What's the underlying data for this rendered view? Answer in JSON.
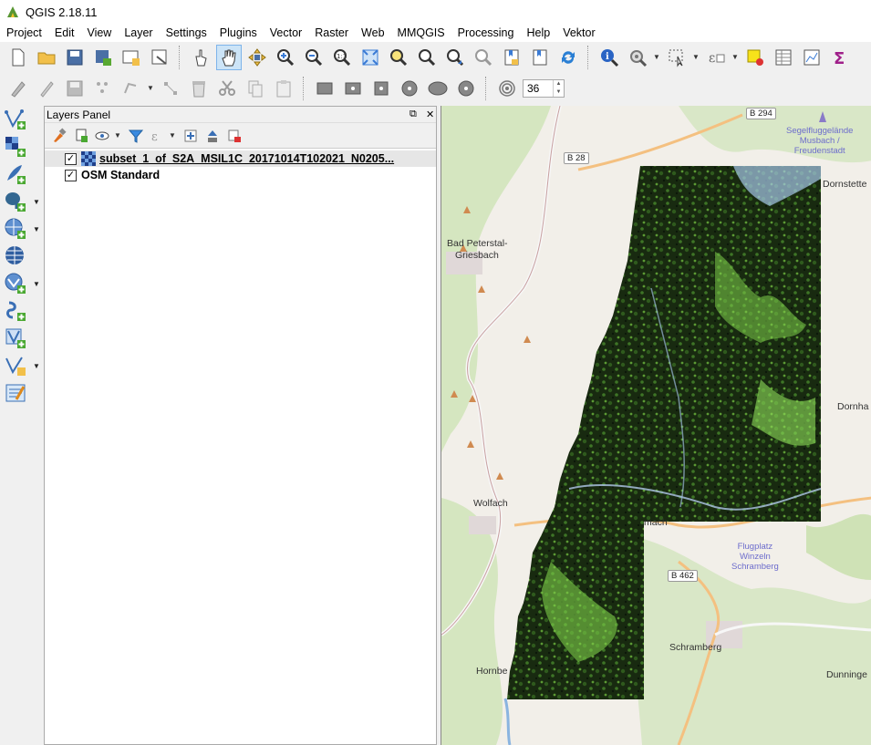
{
  "window": {
    "title": "QGIS 2.18.11",
    "app_icon": "qgis-icon"
  },
  "menubar": {
    "items": [
      "Project",
      "Edit",
      "View",
      "Layer",
      "Settings",
      "Plugins",
      "Vector",
      "Raster",
      "Web",
      "MMQGIS",
      "Processing",
      "Help",
      "Vektor"
    ]
  },
  "toolbar": {
    "rotation_value": "36"
  },
  "layers_panel": {
    "title": "Layers Panel",
    "layers": [
      {
        "name": "subset_1_of_S2A_MSIL1C_20171014T102021_N0205...",
        "checked": "✓",
        "type": "raster",
        "selected": true
      },
      {
        "name": "OSM Standard",
        "checked": "✓",
        "type": "tile",
        "selected": false
      }
    ]
  },
  "map": {
    "places": {
      "bad_peterstal_1": "Bad Peterstal-",
      "bad_peterstal_2": "Griesbach",
      "wolfach": "Wolfach",
      "schramberg": "Schramberg",
      "hornberg": "Hornbe",
      "dornstetten": "Dornstette",
      "dornhan": "Dornha",
      "dunningen": "Dunninge",
      "mach": "mach",
      "segelflug_1": "Segelfluggelände",
      "segelflug_2": "Musbach /",
      "segelflug_3": "Freudenstadt",
      "flugplatz_1": "Flugplatz",
      "flugplatz_2": "Winzeln",
      "flugplatz_3": "Schramberg"
    },
    "roads": {
      "b294": "B 294",
      "b28": "B 28",
      "b462": "B 462"
    },
    "colors": {
      "land": "#f2efe9",
      "forest": "#cfe3b4",
      "raster_dark": "#17250f",
      "raster_green": "#7fd04a"
    }
  }
}
